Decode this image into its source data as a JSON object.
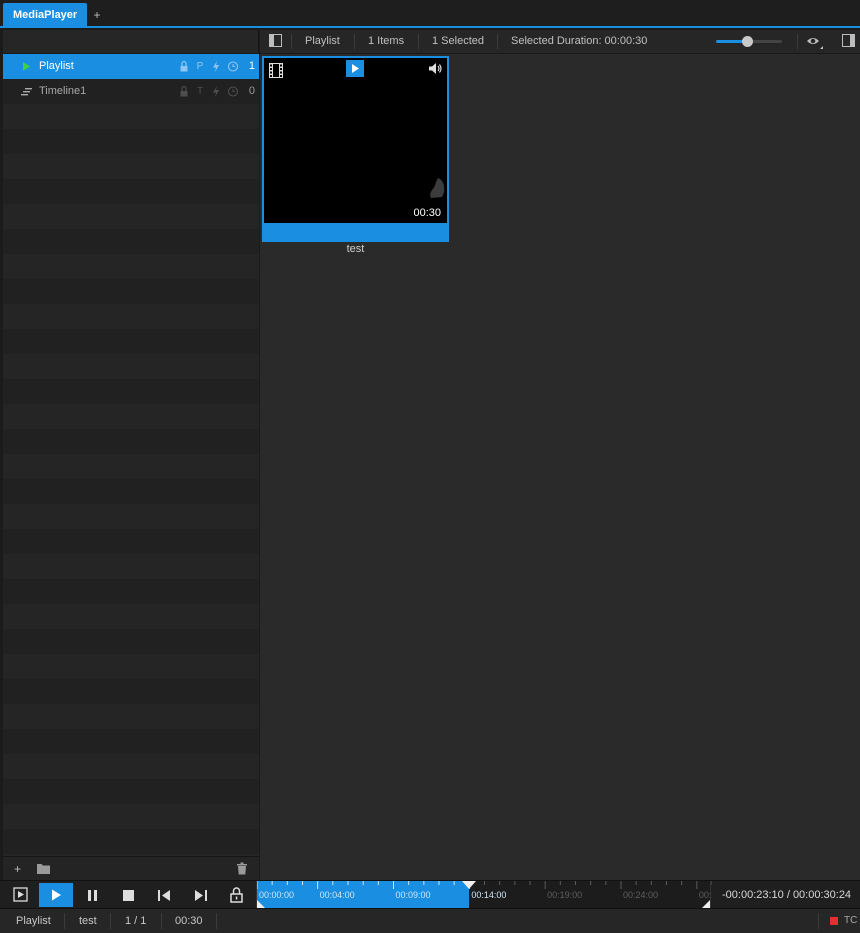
{
  "tabs": {
    "active_label": "MediaPlayer",
    "add_label": "+"
  },
  "playlists": [
    {
      "name": "Playlist",
      "flags": [
        "lock",
        "P",
        "bolt",
        "clock"
      ],
      "count": "1",
      "selected": true,
      "icon": "play-icon"
    },
    {
      "name": "Timeline1",
      "flags": [
        "lock",
        "T",
        "bolt",
        "clock"
      ],
      "count": "0",
      "selected": false,
      "icon": "timeline-icon"
    }
  ],
  "left_footer": {
    "add_label": "+"
  },
  "toolbar": {
    "playlist_label": "Playlist",
    "items_label": "1 Items",
    "selected_label": "1 Selected",
    "duration_label": "Selected Duration: 00:00:30",
    "zoom_level": 0.48
  },
  "thumbnail": {
    "title": "test",
    "duration": "00:30"
  },
  "timeline": {
    "start": "00:00:00",
    "end": "00:00:30",
    "position": "00:00:14",
    "tick_labels": [
      "00:00:00",
      "00:04:00",
      "00:09:00",
      "00:14:00",
      "00:19:00",
      "00:24:00",
      "00:29:00"
    ],
    "timecode": "-00:00:23:10 / 00:00:30:24"
  },
  "status": {
    "playlist": "Playlist",
    "clip": "test",
    "index": "1 / 1",
    "duration": "00:30",
    "tc_label": "TC"
  },
  "colors": {
    "accent": "#1a8ee0",
    "play_green": "#3fd13f",
    "record_red": "#e03030"
  }
}
